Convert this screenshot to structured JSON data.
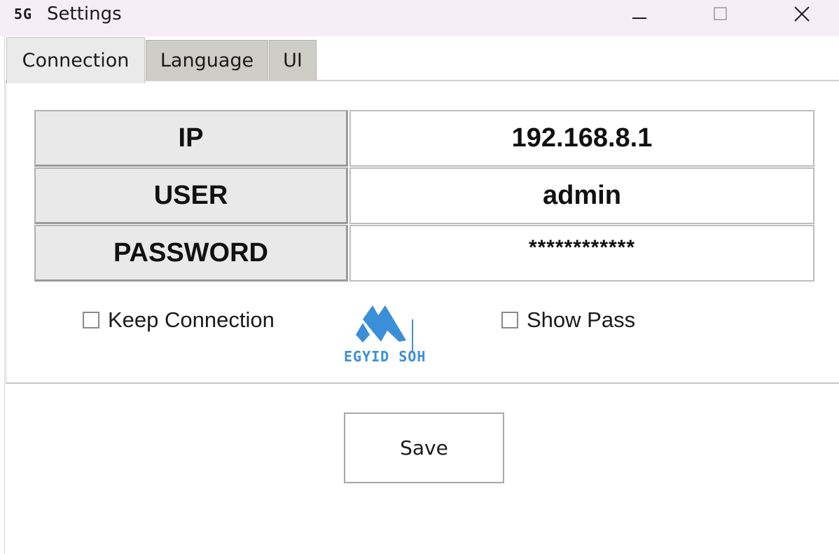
{
  "window": {
    "app_icon_text": "5G",
    "title": "Settings"
  },
  "tabs": [
    {
      "label": "Connection",
      "selected": true
    },
    {
      "label": "Language",
      "selected": false
    },
    {
      "label": "UI",
      "selected": false
    }
  ],
  "form": {
    "ip_label": "IP",
    "ip_value": "192.168.8.1",
    "user_label": "USER",
    "user_value": "admin",
    "password_label": "PASSWORD",
    "password_value": "************"
  },
  "options": {
    "keep_connection_label": "Keep Connection",
    "keep_connection_checked": false,
    "show_pass_label": "Show Pass",
    "show_pass_checked": false
  },
  "logo": {
    "text": "EGYID SOHO",
    "color": "#3b8fd9"
  },
  "actions": {
    "save_label": "Save"
  }
}
